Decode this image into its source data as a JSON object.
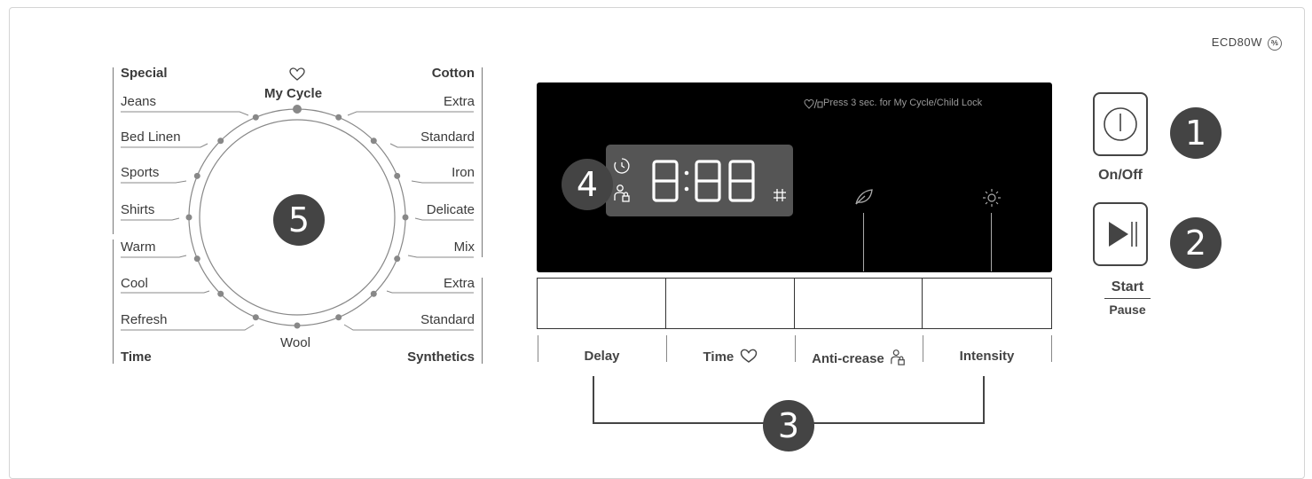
{
  "model": {
    "name": "ECD80W",
    "logo_text": "℁"
  },
  "dial": {
    "top_label": "My Cycle",
    "bottom_label": "Wool",
    "badge": "5",
    "left": [
      {
        "label": "Special",
        "bold": true
      },
      {
        "label": "Jeans"
      },
      {
        "label": "Bed Linen"
      },
      {
        "label": "Sports"
      },
      {
        "label": "Shirts"
      },
      {
        "label": "Warm"
      },
      {
        "label": "Cool"
      },
      {
        "label": "Refresh"
      },
      {
        "label": "Time",
        "bold": true
      }
    ],
    "right": [
      {
        "label": "Cotton",
        "bold": true
      },
      {
        "label": "Extra"
      },
      {
        "label": "Standard"
      },
      {
        "label": "Iron"
      },
      {
        "label": "Delicate"
      },
      {
        "label": "Mix"
      },
      {
        "label": "Extra"
      },
      {
        "label": "Standard"
      },
      {
        "label": "Synthetics",
        "bold": true
      }
    ]
  },
  "display": {
    "hint": "Press 3 sec. for  My Cycle/Child Lock",
    "digits": "8:88",
    "badge": "4"
  },
  "buttons": {
    "badge": "3",
    "items": [
      {
        "label": "Delay"
      },
      {
        "label": "Time"
      },
      {
        "label": "Anti-crease"
      },
      {
        "label": "Intensity"
      }
    ]
  },
  "power": {
    "label": "On/Off",
    "badge": "1"
  },
  "start": {
    "label": "Start",
    "sublabel": "Pause",
    "badge": "2"
  }
}
